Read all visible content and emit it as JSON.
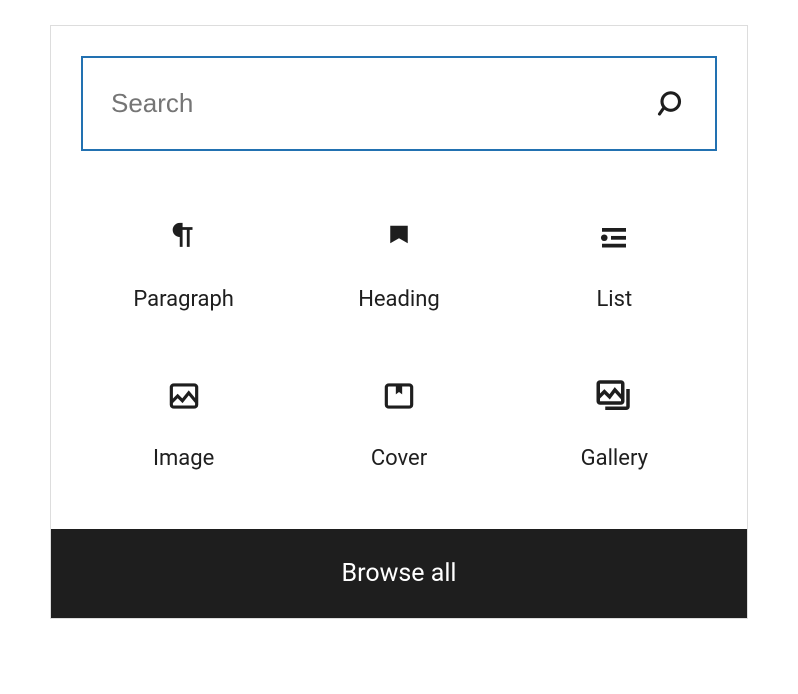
{
  "search": {
    "placeholder": "Search",
    "value": ""
  },
  "blocks": {
    "items": [
      {
        "label": "Paragraph",
        "icon": "paragraph-icon"
      },
      {
        "label": "Heading",
        "icon": "heading-icon"
      },
      {
        "label": "List",
        "icon": "list-icon"
      },
      {
        "label": "Image",
        "icon": "image-icon"
      },
      {
        "label": "Cover",
        "icon": "cover-icon"
      },
      {
        "label": "Gallery",
        "icon": "gallery-icon"
      }
    ]
  },
  "footer": {
    "browse_all_label": "Browse all"
  }
}
